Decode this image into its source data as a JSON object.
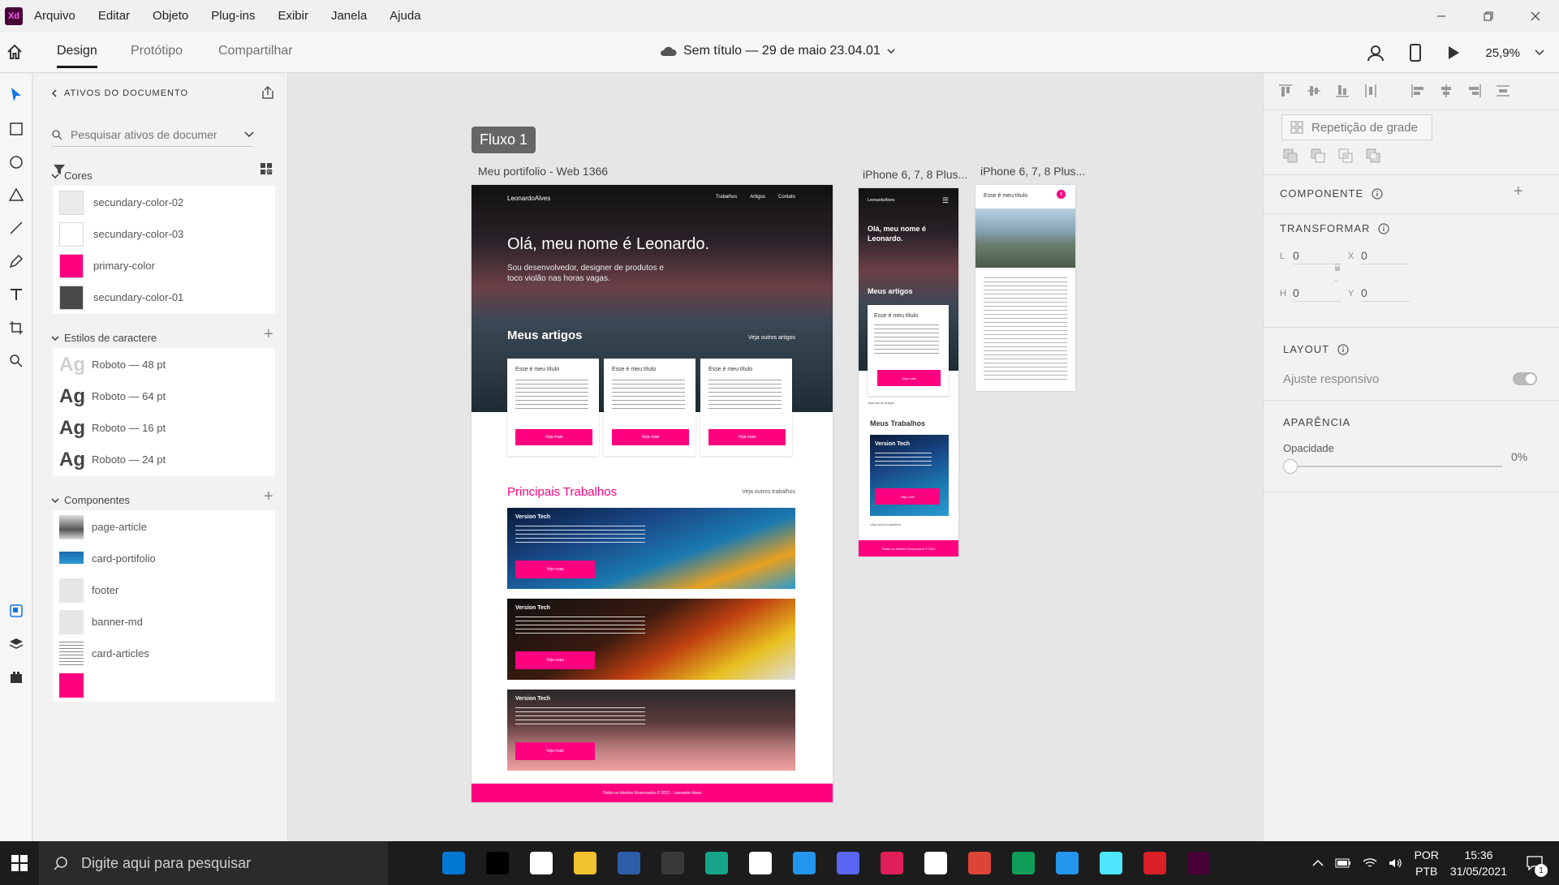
{
  "menubar": {
    "app_icon_text": "Xd",
    "items": [
      "Arquivo",
      "Editar",
      "Objeto",
      "Plug-ins",
      "Exibir",
      "Janela",
      "Ajuda"
    ]
  },
  "header": {
    "tabs": [
      "Design",
      "Protótipo",
      "Compartilhar"
    ],
    "active_tab": "Design",
    "doc_title": "Sem título — 29 de maio 23.04.01",
    "zoom": "25,9%"
  },
  "assets": {
    "title": "ATIVOS DO DOCUMENTO",
    "search_placeholder": "Pesquisar ativos de documento",
    "sections": {
      "colors": {
        "title": "Cores",
        "items": [
          {
            "name": "secundary-color-02",
            "color": "#ebebeb"
          },
          {
            "name": "secundary-color-03",
            "color": "#ffffff"
          },
          {
            "name": "primary-color",
            "color": "#ff0080"
          },
          {
            "name": "secundary-color-01",
            "color": "#4a4a4a"
          }
        ]
      },
      "char_styles": {
        "title": "Estilos de caractere",
        "glyph": "Ag",
        "items": [
          "Roboto — 48 pt",
          "Roboto — 64 pt",
          "Roboto — 16 pt",
          "Roboto — 24 pt"
        ]
      },
      "components": {
        "title": "Componentes",
        "items": [
          "page-article",
          "card-portifolio",
          "footer",
          "banner-md",
          "card-articles"
        ]
      }
    }
  },
  "canvas": {
    "flow_tag": "Fluxo 1",
    "web_label": "Meu portifolio - Web 1366",
    "iphone1_label": "iPhone 6, 7, 8 Plus...",
    "iphone2_label": "iPhone 6, 7, 8 Plus...",
    "web": {
      "brand": "LeonardoAlves",
      "nav": [
        "Trabalhos",
        "Artigos",
        "Contato"
      ],
      "hero_title": "Olá, meu nome é Leonardo.",
      "hero_sub": "Sou desenvolvedor, designer de produtos e toco violão nas horas vagas.",
      "articles_title": "Meus artigos",
      "articles_more": "Veja outros artigos",
      "card_title": "Esse é meu título",
      "card_button": "Veja mais",
      "works_title": "Principais Trabalhos",
      "works_more": "Veja outros trabalhos",
      "work_title": "Version Tech",
      "work_button": "Veja mais",
      "footer": "Todos os direitos Reservados © 2021 - Leonardo Alves"
    },
    "iphone1": {
      "brand": "LeonardoAlves",
      "hero_title": "Olá, meu nome é Leonardo.",
      "articles_title": "Meus artigos",
      "card_title": "Esse é meu título",
      "card_button": "Veja mais",
      "articles_more": "Veja outros artigos",
      "works_title": "Meus Trabalhos",
      "work_title": "Version Tech",
      "work_button": "Veja mais",
      "works_more": "Veja outros trabalhos",
      "footer": "Todos os direitos Reservados © 2021"
    },
    "iphone2": {
      "title": "Esse é meu título",
      "close": "x"
    }
  },
  "props": {
    "repeat_grid": "Repetição de grade",
    "component": "COMPONENTE",
    "transform": "TRANSFORMAR",
    "fields": {
      "l_label": "L",
      "l_value": "0",
      "x_label": "X",
      "x_value": "0",
      "h_label": "H",
      "h_value": "0",
      "y_label": "Y",
      "y_value": "0"
    },
    "layout": "LAYOUT",
    "responsive": "Ajuste responsivo",
    "appearance": "APARÊNCIA",
    "opacity_label": "Opacidade",
    "opacity_value": "0%",
    "opacity_fraction": 0
  },
  "taskbar": {
    "search_placeholder": "Digite aqui para pesquisar",
    "language": "POR",
    "layout": "PTB",
    "time": "15:36",
    "date": "31/05/2021",
    "notifications": "1",
    "apps": [
      {
        "name": "task-view-icon",
        "color": "#1c1c1c"
      },
      {
        "name": "vscode-icon",
        "color": "#0078d4"
      },
      {
        "name": "intellij-icon",
        "color": "#000000"
      },
      {
        "name": "typora-icon",
        "color": "#ffffff"
      },
      {
        "name": "file-explorer-icon",
        "color": "#f2c12e"
      },
      {
        "name": "powershell-icon",
        "color": "#2c5ea8"
      },
      {
        "name": "terminal-icon",
        "color": "#3a3a3a"
      },
      {
        "name": "gitkraken-icon",
        "color": "#17a589"
      },
      {
        "name": "github-icon",
        "color": "#ffffff"
      },
      {
        "name": "docker-icon",
        "color": "#2496ed"
      },
      {
        "name": "discord-icon",
        "color": "#5865f2"
      },
      {
        "name": "slack-icon",
        "color": "#e01e5a"
      },
      {
        "name": "cloud-icon",
        "color": "#ffffff"
      },
      {
        "name": "chrome-icon",
        "color": "#db4437"
      },
      {
        "name": "chrome-profile-icon",
        "color": "#0f9d58"
      },
      {
        "name": "docker-desktop-icon",
        "color": "#2496ed"
      },
      {
        "name": "azure-storage-icon",
        "color": "#50e6ff"
      },
      {
        "name": "creative-cloud-icon",
        "color": "#da1f26"
      },
      {
        "name": "adobe-xd-icon",
        "color": "#470137"
      }
    ]
  }
}
